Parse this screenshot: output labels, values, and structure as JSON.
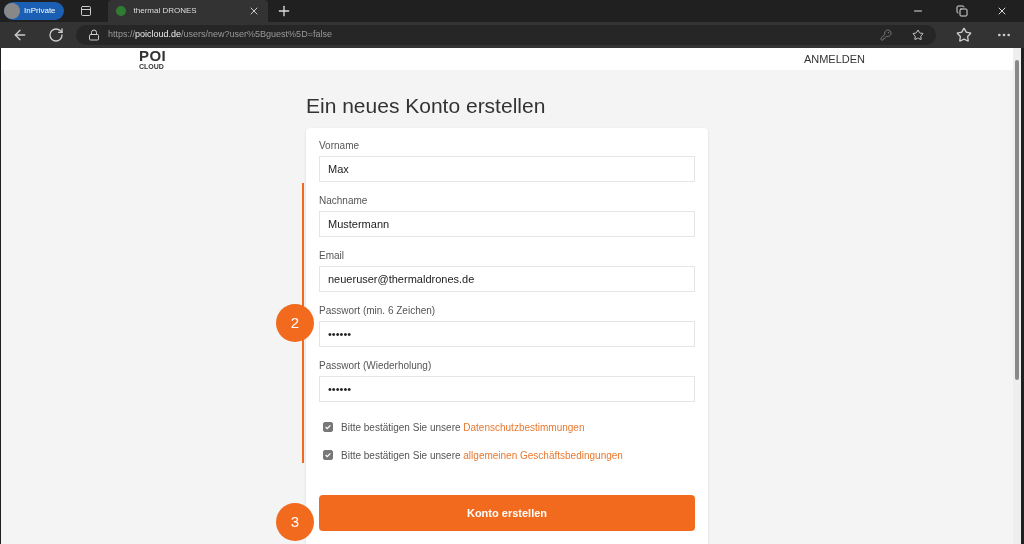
{
  "browser": {
    "profile": "InPrivate",
    "tabs": [
      {
        "title": "thermal DRONES",
        "selected": true
      }
    ],
    "url": {
      "scheme": "https://",
      "domain": "poicloud.de",
      "path": "/users/new?user%5Bguest%5D=false"
    }
  },
  "header": {
    "logo_top": "POI",
    "logo_bottom": "CLOUD",
    "login": "ANMELDEN"
  },
  "title": "Ein neues Konto erstellen",
  "fields": [
    {
      "label": "Vorname",
      "value": "Max"
    },
    {
      "label": "Nachname",
      "value": "Mustermann"
    },
    {
      "label": "Email",
      "value": "neueruser@thermaldrones.de"
    },
    {
      "label": "Passwort (min. 6 Zeichen)",
      "value": "••••••"
    },
    {
      "label": "Passwort (Wiederholung)",
      "value": "••••••"
    }
  ],
  "checkboxes": [
    {
      "text": "Bitte bestätigen Sie unsere",
      "link": "Datenschutzbestimmungen",
      "checked": true
    },
    {
      "text": "Bitte bestätigen Sie unsere",
      "link": "allgemeinen Geschäftsbedingungen",
      "checked": true
    }
  ],
  "submit": "Konto erstellen",
  "steps": [
    {
      "number": "2"
    },
    {
      "number": "3"
    }
  ]
}
